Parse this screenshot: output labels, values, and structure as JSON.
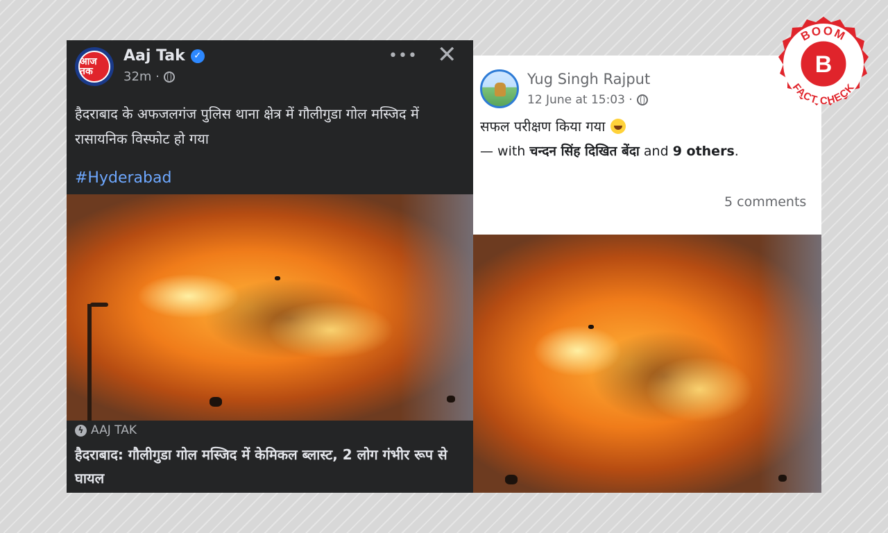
{
  "left_post": {
    "logo_text": "आज तक",
    "page_name": "Aaj Tak",
    "timestamp": "32m ·",
    "more_icon": "more-horizontal-icon",
    "close_icon": "close-icon",
    "text": "हैदराबाद के अफजलगंज पुलिस थाना क्षेत्र में गौलीगुडा गोल मस्जिद में रासायनिक विस्फोट हो गया",
    "hashtag": "#Hyderabad",
    "link_source": "AAJ TAK",
    "link_title": "हैदराबाद: गौलीगुडा गोल मस्जिद में केमिकल ब्लास्ट, 2 लोग गंभीर रूप से घायल"
  },
  "right_post": {
    "author": "Yug Singh Rajput",
    "timestamp": "12 June at 15:03 ·",
    "text": "सफल परीक्षण किया गया",
    "with_prefix": "— with",
    "tagged_name": "चन्दन सिंह दिखित बेंदा",
    "and_text": "and",
    "others": "9 others",
    "period": ".",
    "comments": "5 comments"
  },
  "badge": {
    "top_text": "BOOM",
    "letter": "B",
    "bottom_text": "FACT CHECK",
    "colors": {
      "red": "#e0242b",
      "white": "#ffffff"
    }
  },
  "colors": {
    "facebook_dark_bg": "#242526",
    "facebook_link_blue": "#6ea8ff",
    "verified_blue": "#2d88ff"
  }
}
